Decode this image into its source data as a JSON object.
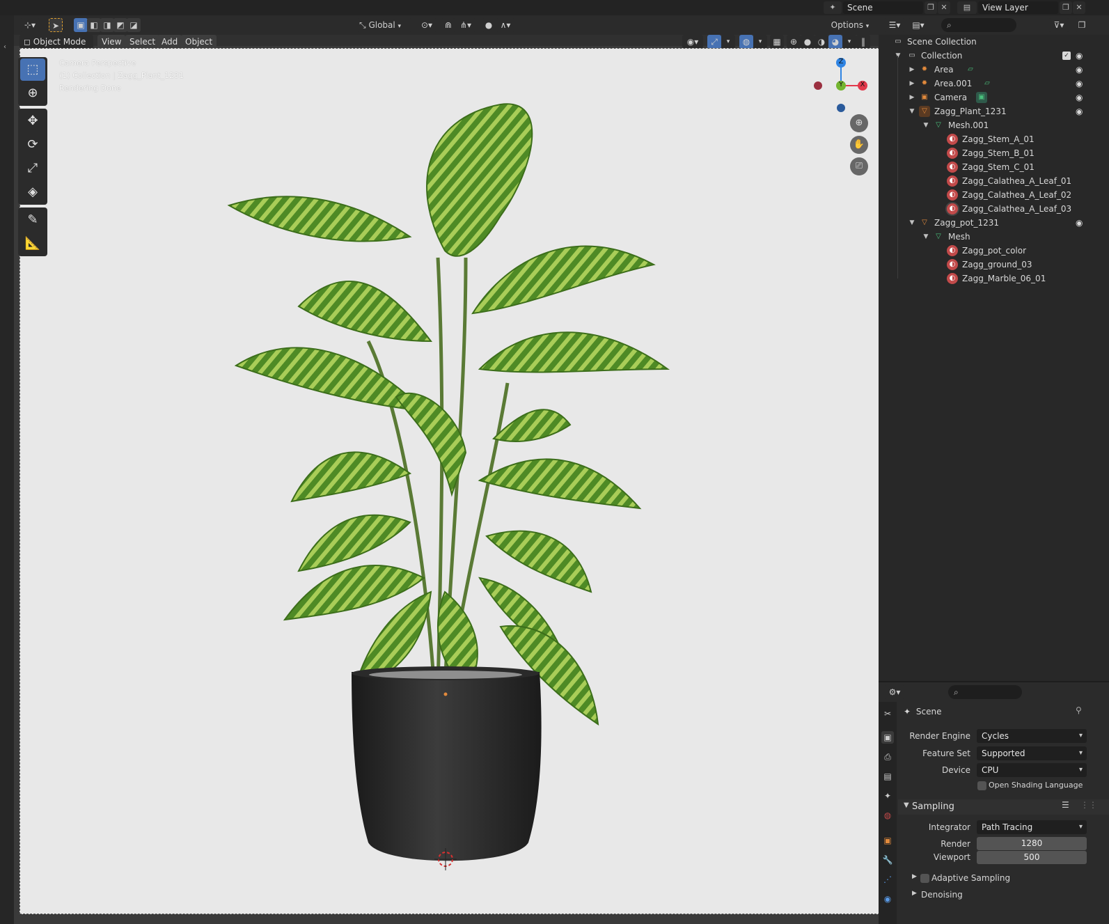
{
  "topbar": {
    "scene_label": "Scene",
    "view_layer_label": "View Layer"
  },
  "viewport_header": {
    "orientation": "Global",
    "options_label": "Options",
    "mode": "Object Mode",
    "menu": [
      "View",
      "Select",
      "Add",
      "Object"
    ]
  },
  "viewport_overlay": {
    "line1": "Camera Perspective",
    "line2": "(1) Collection | Zagg_Plant_1231",
    "line3": "Rendering Done"
  },
  "gizmo": {
    "z": "Z",
    "y": "Y",
    "x": "X"
  },
  "outliner": {
    "scene_collection": "Scene Collection",
    "collection": "Collection",
    "area": "Area",
    "area001": "Area.001",
    "camera": "Camera",
    "plant": "Zagg_Plant_1231",
    "mesh001": "Mesh.001",
    "stem_a": "Zagg_Stem_A_01",
    "stem_b": "Zagg_Stem_B_01",
    "stem_c": "Zagg_Stem_C_01",
    "leaf01": "Zagg_Calathea_A_Leaf_01",
    "leaf02": "Zagg_Calathea_A_Leaf_02",
    "leaf03": "Zagg_Calathea_A_Leaf_03",
    "pot": "Zagg_pot_1231",
    "mesh": "Mesh",
    "pot_color": "Zagg_pot_color",
    "ground": "Zagg_ground_03",
    "marble": "Zagg_Marble_06_01"
  },
  "properties": {
    "context": "Scene",
    "render_engine_label": "Render Engine",
    "render_engine": "Cycles",
    "feature_set_label": "Feature Set",
    "feature_set": "Supported",
    "device_label": "Device",
    "device": "CPU",
    "osl_label": "Open Shading Language",
    "sampling_label": "Sampling",
    "integrator_label": "Integrator",
    "integrator": "Path Tracing",
    "render_label": "Render",
    "render_samples": "1280",
    "viewport_label": "Viewport",
    "viewport_samples": "500",
    "adaptive_label": "Adaptive Sampling",
    "denoising_label": "Denoising"
  },
  "colors": {
    "accent": "#4772b3",
    "axis_x": "#e2384b",
    "axis_y": "#73b52f",
    "axis_z": "#2f84e3",
    "object_orange": "#e28a3c",
    "material_red": "#c24a4a"
  }
}
